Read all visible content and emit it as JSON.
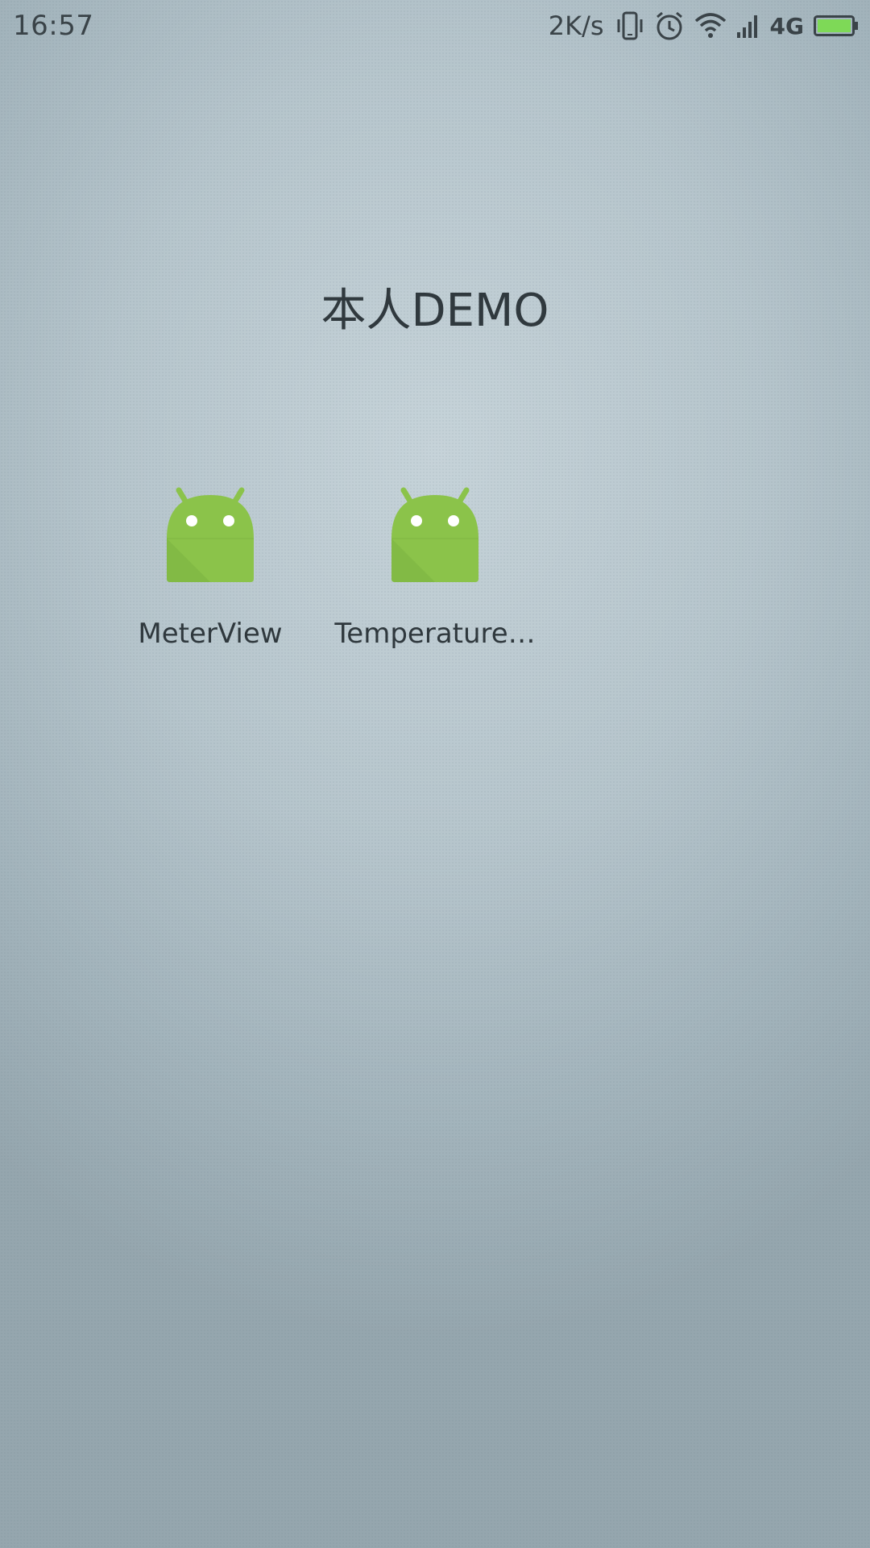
{
  "status_bar": {
    "time": "16:57",
    "net_speed": "2K/s",
    "network_type": "4G",
    "icons": [
      "vibrate-icon",
      "alarm-icon",
      "wifi-icon",
      "signal-icon",
      "battery-icon"
    ]
  },
  "folder": {
    "title": "本人DEMO",
    "apps": [
      {
        "label": "MeterView",
        "icon": "android-icon"
      },
      {
        "label": "Temperature…",
        "icon": "android-icon"
      }
    ]
  },
  "colors": {
    "android_green": "#8bc34a",
    "battery_green": "#7ed957",
    "text_dark": "#30393e"
  }
}
